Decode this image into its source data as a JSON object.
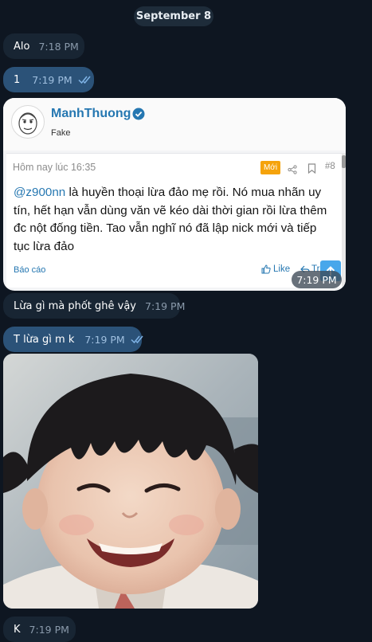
{
  "date_separator": "September 8",
  "messages": [
    {
      "text": "Alo",
      "time": "7:18 PM"
    },
    {
      "text": "1",
      "time": "7:19 PM"
    },
    {
      "text": "Lừa gì mà phốt ghê vậy",
      "time": "7:19 PM"
    },
    {
      "text": "T lừa gì m k",
      "time": "7:19 PM"
    },
    {
      "text": "K",
      "time": "7:19 PM"
    }
  ],
  "forum_card": {
    "username": "ManhThuong",
    "user_title": "Fake",
    "post_time": "Hôm nay lúc 16:35",
    "new_badge": "Mới",
    "post_number": "#8",
    "mention": "@z900nn",
    "body": " là huyền thoại lừa đảo mẹ rồi. Nó mua nhãn uy tín, hết hạn vẫn dùng văn vẽ kéo dài thời gian rồi lừa thêm đc nột đống tiền. Tao vẫn nghĩ nó đã lập nick mới và tiếp tục lừa đảo",
    "report_label": "Báo cáo",
    "like_label": "Like",
    "reply_label_partial": "Tr",
    "time": "7:19 PM"
  },
  "colors": {
    "background": "#0e1621",
    "incoming_bubble": "#182533",
    "outgoing_bubble": "#2b5278",
    "forum_link": "#2577b1",
    "new_badge": "#f5a30c"
  }
}
